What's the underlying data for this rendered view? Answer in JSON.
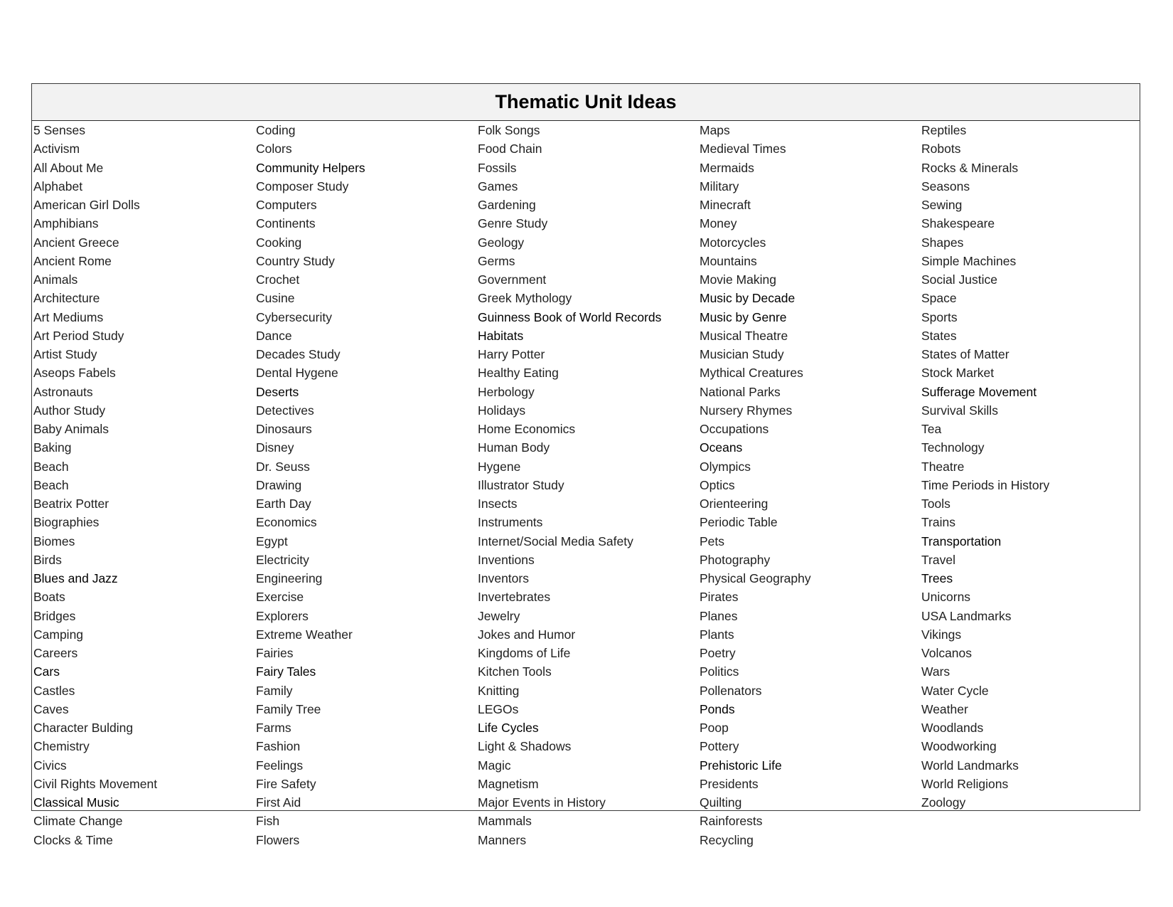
{
  "document": {
    "title": "Thematic Unit Ideas",
    "header_bg": "#f2f2f2",
    "columns": [
      {
        "items": [
          "5 Senses",
          "Activism",
          "All About Me",
          "Alphabet",
          "American Girl Dolls",
          "Amphibians",
          "Ancient Greece",
          "Ancient Rome",
          "Animals",
          "Architecture",
          "Art Mediums",
          "Art Period Study",
          "Artist Study",
          "Aseops Fabels",
          "Astronauts",
          "Author Study",
          "Baby Animals",
          "Baking",
          "Beach",
          "Beach",
          "Beatrix Potter",
          "Biographies",
          "Biomes",
          "Birds",
          "Blues and Jazz",
          "Boats",
          "Bridges",
          "Camping",
          "Careers",
          "Cars",
          "Castles",
          "Caves",
          "Character Bulding",
          "Chemistry",
          "Civics",
          "Civil Rights Movement",
          "Classical Music",
          "Climate Change",
          "Clocks & Time"
        ]
      },
      {
        "items": [
          "Coding",
          "Colors",
          "Community Helpers",
          "Composer Study",
          "Computers",
          "Continents",
          "Cooking",
          "Country Study",
          "Crochet",
          "Cusine",
          "Cybersecurity",
          "Dance",
          "Decades Study",
          "Dental Hygene",
          "Deserts",
          "Detectives",
          "Dinosaurs",
          "Disney",
          "Dr. Seuss",
          "Drawing",
          "Earth Day",
          "Economics",
          "Egypt",
          "Electricity",
          "Engineering",
          "Exercise",
          "Explorers",
          "Extreme Weather",
          "Fairies",
          "Fairy Tales",
          "Family",
          "Family Tree",
          "Farms",
          "Fashion",
          "Feelings",
          "Fire Safety",
          "First Aid",
          "Fish",
          "Flowers"
        ]
      },
      {
        "items": [
          "Folk Songs",
          "Food Chain",
          "Fossils",
          "Games",
          "Gardening",
          "Genre Study",
          "Geology",
          "Germs",
          "Government",
          "Greek Mythology",
          "Guinness Book of World Records",
          "Habitats",
          "Harry Potter",
          "Healthy Eating",
          "Herbology",
          "Holidays",
          "Home Economics",
          "Human Body",
          "Hygene",
          "Illustrator Study",
          "Insects",
          "Instruments",
          "Internet/Social Media Safety",
          "Inventions",
          "Inventors",
          "Invertebrates",
          "Jewelry",
          "Jokes and Humor",
          "Kingdoms of Life",
          "Kitchen Tools",
          "Knitting",
          "LEGOs",
          "Life Cycles",
          "Light & Shadows",
          "Magic",
          "Magnetism",
          "Major Events in History",
          "Mammals",
          "Manners"
        ]
      },
      {
        "items": [
          "Maps",
          "Medieval Times",
          "Mermaids",
          "Military",
          "Minecraft",
          "Money",
          "Motorcycles",
          "Mountains",
          "Movie Making",
          "Music by Decade",
          "Music by Genre",
          "Musical Theatre",
          "Musician Study",
          "Mythical Creatures",
          "National Parks",
          "Nursery Rhymes",
          "Occupations",
          "Oceans",
          "Olympics",
          "Optics",
          "Orienteering",
          "Periodic Table",
          "Pets",
          "Photography",
          "Physical Geography",
          "Pirates",
          "Planes",
          "Plants",
          "Poetry",
          "Politics",
          "Pollenators",
          "Ponds",
          "Poop",
          "Pottery",
          "Prehistoric Life",
          "Presidents",
          "Quilting",
          "Rainforests",
          "Recycling"
        ]
      },
      {
        "items": [
          "Reptiles",
          "Robots",
          "Rocks & Minerals",
          "Seasons",
          "Sewing",
          "Shakespeare",
          "Shapes",
          "Simple Machines",
          "Social Justice",
          "Space",
          "Sports",
          "States",
          "States of Matter",
          "Stock Market",
          "Sufferage Movement",
          "Survival Skills",
          "Tea",
          "Technology",
          "Theatre",
          "Time Periods in History",
          "Tools",
          "Trains",
          "Transportation",
          "Travel",
          "Trees",
          "Unicorns",
          "USA Landmarks",
          "Vikings",
          "Volcanos",
          "Wars",
          "Water Cycle",
          "Weather",
          "Woodlands",
          "Woodworking",
          "World Landmarks",
          "World Religions",
          "Zoology"
        ]
      }
    ]
  }
}
